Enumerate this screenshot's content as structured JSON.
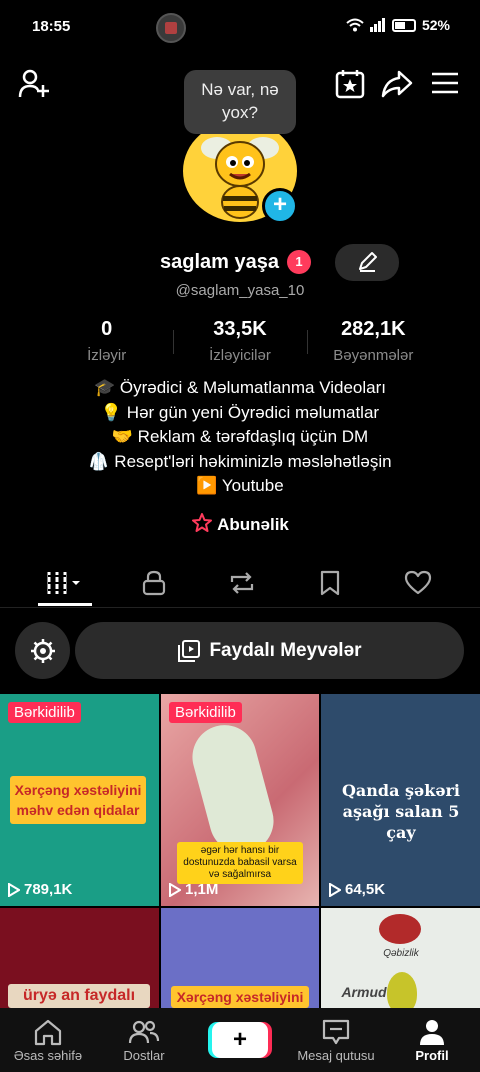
{
  "status_bar": {
    "time": "18:55",
    "battery": "52%"
  },
  "bubble": "Nə var, nə yox?",
  "profile": {
    "name": "saglam yaşa",
    "badge": "1",
    "handle": "@saglam_yasa_10"
  },
  "stats": [
    {
      "value": "0",
      "label": "İzləyir"
    },
    {
      "value": "33,5K",
      "label": "İzləyicilər"
    },
    {
      "value": "282,1K",
      "label": "Bəyənmələr"
    }
  ],
  "bio": [
    "🎓 Öyrədici & Məlumatlanma Videoları",
    "💡 Hər gün yeni Öyrədici məlumatlar",
    "🤝 Reklam & tərəfdaşlıq üçün DM",
    "🥼 Resept'ləri həkiminizlə məsləhətləşin",
    "▶️ Youtube"
  ],
  "subscription": "Abunəlik",
  "playlist": "Faydalı Meyvələr",
  "videos": [
    {
      "pinned": "Bərkidilib",
      "caption": "Xərçəng xəstəliyini məhv edən qidalar",
      "views": "789,1K"
    },
    {
      "pinned": "Bərkidilib",
      "caption": "əgər hər hansı bir dostunuzda babasil varsa və sağalmırsa",
      "views": "1,1M"
    },
    {
      "caption": "Qanda şəkəri aşağı salan 5 çay",
      "views": "64,5K"
    },
    {
      "caption": "üryə an faydalı"
    },
    {
      "caption": "Xərçəng xəstəliyini"
    },
    {
      "caption": "Armud",
      "caption2": "Qəbizlik"
    }
  ],
  "nav": [
    {
      "label": "Əsas səhifə"
    },
    {
      "label": "Dostlar"
    },
    {
      "label": ""
    },
    {
      "label": "Mesaj qutusu"
    },
    {
      "label": "Profil"
    }
  ],
  "colors": {
    "accent_red": "#ff2d55",
    "accent_cyan": "#20b6e6",
    "bg": "#000000"
  }
}
